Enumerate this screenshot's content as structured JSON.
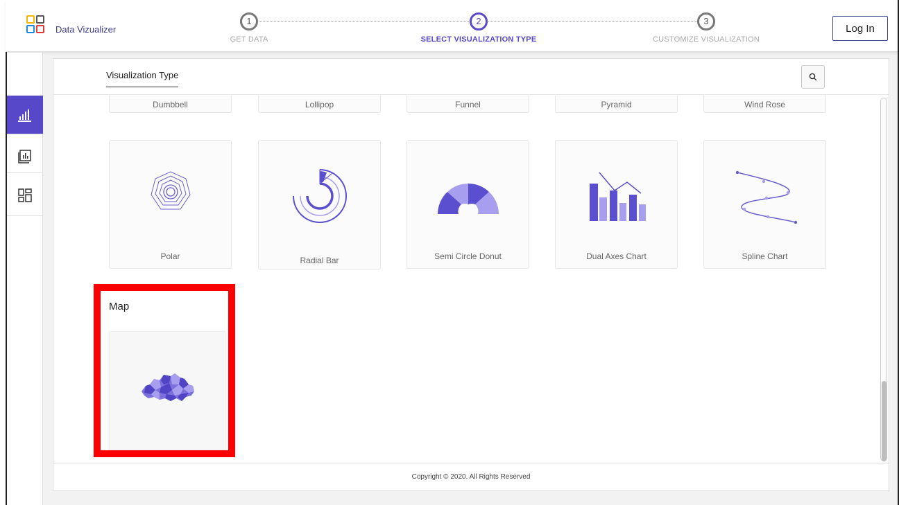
{
  "app": {
    "title": "Data Vizualizer"
  },
  "steps": [
    {
      "number": "1",
      "label": "GET DATA"
    },
    {
      "number": "2",
      "label": "SELECT VISUALIZATION TYPE"
    },
    {
      "number": "3",
      "label": "CUSTOMIZE VISUALIZATION"
    }
  ],
  "header": {
    "login_label": "Log In"
  },
  "sidebar": {
    "items": [
      "bar-chart-icon",
      "report-icon",
      "dashboard-icon"
    ]
  },
  "panel": {
    "tab_label": "Visualization Type",
    "search_icon": "search-icon"
  },
  "charts_row_top": [
    "Dumbbell",
    "Lollipop",
    "Funnel",
    "Pyramid",
    "Wind Rose"
  ],
  "charts_row_main": [
    "Polar",
    "Radial Bar",
    "Semi Circle Donut",
    "Dual Axes Chart",
    "Spline Chart"
  ],
  "map_section": {
    "title": "Map",
    "icon": "map-icon"
  },
  "footer": {
    "copyright": "Copyright © 2020. All Rights Reserved"
  },
  "colors": {
    "accent": "#5747c9",
    "accent_light": "#a89ef0",
    "highlight": "#ff0000"
  }
}
